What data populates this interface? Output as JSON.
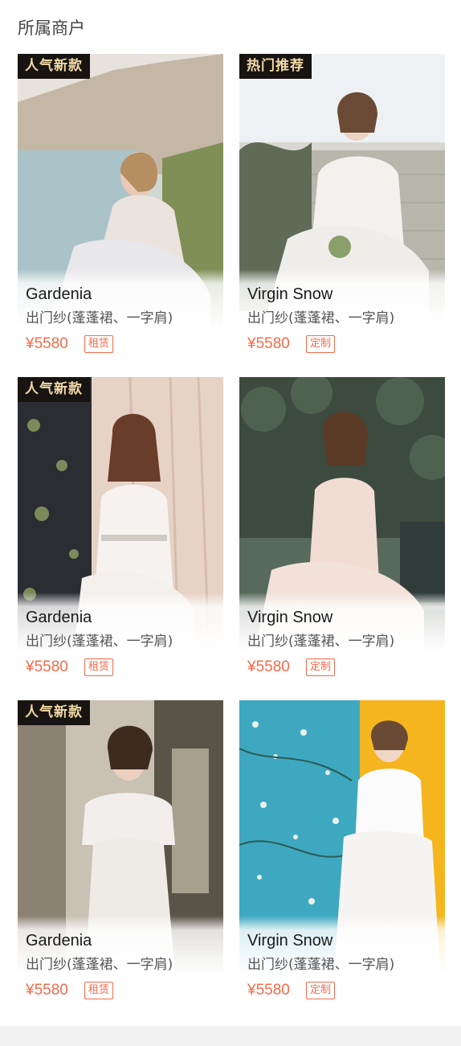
{
  "section": {
    "title": "所属商户"
  },
  "products": [
    {
      "tag": "人气新款",
      "name": "Gardenia",
      "desc": "出门纱(蓬蓬裙、一字肩)",
      "price": "¥5580",
      "badge": "租赁",
      "scene": "sea-cliff",
      "accent": "#9fb8c0"
    },
    {
      "tag": "热门推荐",
      "name": "Virgin Snow",
      "desc": "出门纱(蓬蓬裙、一字肩)",
      "price": "¥5580",
      "badge": "定制",
      "scene": "stone-wall",
      "accent": "#b9b4a8"
    },
    {
      "tag": "人气新款",
      "name": "Gardenia",
      "desc": "出门纱(蓬蓬裙、一字肩)",
      "price": "¥5580",
      "badge": "租赁",
      "scene": "curtain",
      "accent": "#e3cbbd"
    },
    {
      "tag": "",
      "name": "Virgin Snow",
      "desc": "出门纱(蓬蓬裙、一字肩)",
      "price": "¥5580",
      "badge": "定制",
      "scene": "forest",
      "accent": "#5e6a55"
    },
    {
      "tag": "人气新款",
      "name": "Gardenia",
      "desc": "出门纱(蓬蓬裙、一字肩)",
      "price": "¥5580",
      "badge": "租赁",
      "scene": "window",
      "accent": "#6b6356"
    },
    {
      "tag": "",
      "name": "Virgin Snow",
      "desc": "出门纱(蓬蓬裙、一字肩)",
      "price": "¥5580",
      "badge": "定制",
      "scene": "blossom",
      "accent": "#f4b51e"
    }
  ],
  "colors": {
    "price": "#f36b4a",
    "tag_bg": "#171411",
    "tag_text": "#f3d9a6",
    "title": "#444444"
  }
}
